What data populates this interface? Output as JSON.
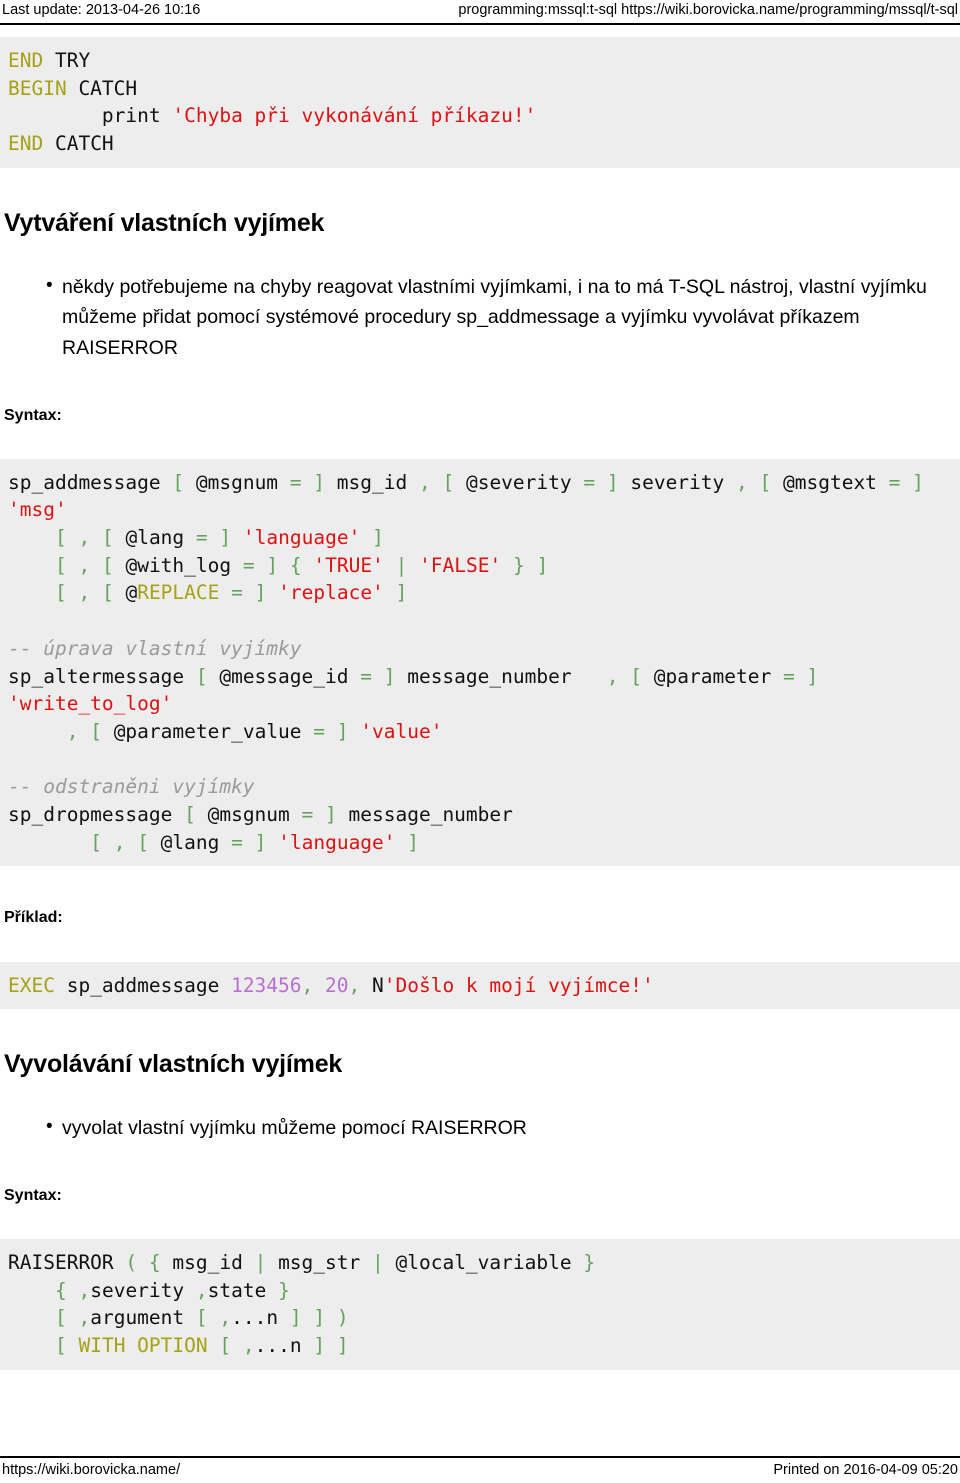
{
  "header": {
    "last_update": "Last update: 2013-04-26 10:16",
    "breadcrumb": "programming:mssql:t-sql https://wiki.borovicka.name/programming/mssql/t-sql"
  },
  "footer": {
    "site_url": "https://wiki.borovicka.name/",
    "printed_on": "Printed on 2016-04-09 05:20"
  },
  "colors": {
    "code_background": "#ededed",
    "keyword": "#a6a215",
    "string": "#dd1111",
    "punctuation": "#63a35c",
    "number": "#b86fd0",
    "comment": "#9a9a9a",
    "rule": "#000000"
  },
  "code_try_catch": {
    "lines": [
      [
        {
          "t": "END",
          "c": "kw"
        },
        {
          "t": " TRY",
          "c": ""
        }
      ],
      [
        {
          "t": "BEGIN",
          "c": "kw"
        },
        {
          "t": " CATCH",
          "c": ""
        }
      ],
      [
        {
          "t": "        print ",
          "c": ""
        },
        {
          "t": "'Chyba při vykonávání příkazu!'",
          "c": "str"
        }
      ],
      [
        {
          "t": "END",
          "c": "kw"
        },
        {
          "t": " CATCH",
          "c": ""
        }
      ]
    ]
  },
  "section_create": {
    "heading": "Vytváření vlastních vyjímek",
    "bullets": [
      "někdy potřebujeme na chyby reagovat vlastními vyjímkami, i na to má T-SQL nástroj, vlastní vyjímku můžeme přidat pomocí systémové procedury sp_addmessage a vyjímku vyvolávat příkazem RAISERROR"
    ],
    "syntax_label": "Syntax:",
    "example_label": "Příklad:"
  },
  "code_sp_syntax": {
    "lines": [
      [
        {
          "t": "sp_addmessage ",
          "c": ""
        },
        {
          "t": "[",
          "c": "pun"
        },
        {
          "t": " @msgnum ",
          "c": ""
        },
        {
          "t": "=",
          "c": "pun"
        },
        {
          "t": " ",
          "c": ""
        },
        {
          "t": "]",
          "c": "pun"
        },
        {
          "t": " msg_id ",
          "c": ""
        },
        {
          "t": ",",
          "c": "pun"
        },
        {
          "t": " ",
          "c": ""
        },
        {
          "t": "[",
          "c": "pun"
        },
        {
          "t": " @severity ",
          "c": ""
        },
        {
          "t": "=",
          "c": "pun"
        },
        {
          "t": " ",
          "c": ""
        },
        {
          "t": "]",
          "c": "pun"
        },
        {
          "t": " severity ",
          "c": ""
        },
        {
          "t": ",",
          "c": "pun"
        },
        {
          "t": " ",
          "c": ""
        },
        {
          "t": "[",
          "c": "pun"
        },
        {
          "t": " @msgtext ",
          "c": ""
        },
        {
          "t": "=",
          "c": "pun"
        },
        {
          "t": " ",
          "c": ""
        },
        {
          "t": "]",
          "c": "pun"
        },
        {
          "t": " ",
          "c": ""
        },
        {
          "t": "'msg'",
          "c": "str"
        }
      ],
      [
        {
          "t": "    ",
          "c": ""
        },
        {
          "t": "[",
          "c": "pun"
        },
        {
          "t": " ",
          "c": ""
        },
        {
          "t": ",",
          "c": "pun"
        },
        {
          "t": " ",
          "c": ""
        },
        {
          "t": "[",
          "c": "pun"
        },
        {
          "t": " @lang ",
          "c": ""
        },
        {
          "t": "=",
          "c": "pun"
        },
        {
          "t": " ",
          "c": ""
        },
        {
          "t": "]",
          "c": "pun"
        },
        {
          "t": " ",
          "c": ""
        },
        {
          "t": "'language'",
          "c": "str"
        },
        {
          "t": " ",
          "c": ""
        },
        {
          "t": "]",
          "c": "pun"
        }
      ],
      [
        {
          "t": "    ",
          "c": ""
        },
        {
          "t": "[",
          "c": "pun"
        },
        {
          "t": " ",
          "c": ""
        },
        {
          "t": ",",
          "c": "pun"
        },
        {
          "t": " ",
          "c": ""
        },
        {
          "t": "[",
          "c": "pun"
        },
        {
          "t": " @with_log ",
          "c": ""
        },
        {
          "t": "=",
          "c": "pun"
        },
        {
          "t": " ",
          "c": ""
        },
        {
          "t": "]",
          "c": "pun"
        },
        {
          "t": " ",
          "c": ""
        },
        {
          "t": "{",
          "c": "pun"
        },
        {
          "t": " ",
          "c": ""
        },
        {
          "t": "'TRUE'",
          "c": "str"
        },
        {
          "t": " ",
          "c": ""
        },
        {
          "t": "|",
          "c": "pun"
        },
        {
          "t": " ",
          "c": ""
        },
        {
          "t": "'FALSE'",
          "c": "str"
        },
        {
          "t": " ",
          "c": ""
        },
        {
          "t": "}",
          "c": "pun"
        },
        {
          "t": " ",
          "c": ""
        },
        {
          "t": "]",
          "c": "pun"
        }
      ],
      [
        {
          "t": "    ",
          "c": ""
        },
        {
          "t": "[",
          "c": "pun"
        },
        {
          "t": " ",
          "c": ""
        },
        {
          "t": ",",
          "c": "pun"
        },
        {
          "t": " ",
          "c": ""
        },
        {
          "t": "[",
          "c": "pun"
        },
        {
          "t": " @",
          "c": ""
        },
        {
          "t": "REPLACE",
          "c": "kw"
        },
        {
          "t": " ",
          "c": ""
        },
        {
          "t": "=",
          "c": "pun"
        },
        {
          "t": " ",
          "c": ""
        },
        {
          "t": "]",
          "c": "pun"
        },
        {
          "t": " ",
          "c": ""
        },
        {
          "t": "'replace'",
          "c": "str"
        },
        {
          "t": " ",
          "c": ""
        },
        {
          "t": "]",
          "c": "pun"
        }
      ],
      [
        {
          "t": "",
          "c": ""
        }
      ],
      [
        {
          "t": "-- úprava vlastní vyjímky",
          "c": "com"
        }
      ],
      [
        {
          "t": "sp_altermessage ",
          "c": ""
        },
        {
          "t": "[",
          "c": "pun"
        },
        {
          "t": " @message_id ",
          "c": ""
        },
        {
          "t": "=",
          "c": "pun"
        },
        {
          "t": " ",
          "c": ""
        },
        {
          "t": "]",
          "c": "pun"
        },
        {
          "t": " message_number   ",
          "c": ""
        },
        {
          "t": ",",
          "c": "pun"
        },
        {
          "t": " ",
          "c": ""
        },
        {
          "t": "[",
          "c": "pun"
        },
        {
          "t": " @parameter ",
          "c": ""
        },
        {
          "t": "=",
          "c": "pun"
        },
        {
          "t": " ",
          "c": ""
        },
        {
          "t": "]",
          "c": "pun"
        },
        {
          "t": " ",
          "c": ""
        },
        {
          "t": "'write_to_log'",
          "c": "str"
        }
      ],
      [
        {
          "t": "     ",
          "c": ""
        },
        {
          "t": ",",
          "c": "pun"
        },
        {
          "t": " ",
          "c": ""
        },
        {
          "t": "[",
          "c": "pun"
        },
        {
          "t": " @parameter_value ",
          "c": ""
        },
        {
          "t": "=",
          "c": "pun"
        },
        {
          "t": " ",
          "c": ""
        },
        {
          "t": "]",
          "c": "pun"
        },
        {
          "t": " ",
          "c": ""
        },
        {
          "t": "'value'",
          "c": "str"
        }
      ],
      [
        {
          "t": "",
          "c": ""
        }
      ],
      [
        {
          "t": "-- odstraněni vyjímky",
          "c": "com"
        }
      ],
      [
        {
          "t": "sp_dropmessage ",
          "c": ""
        },
        {
          "t": "[",
          "c": "pun"
        },
        {
          "t": " @msgnum ",
          "c": ""
        },
        {
          "t": "=",
          "c": "pun"
        },
        {
          "t": " ",
          "c": ""
        },
        {
          "t": "]",
          "c": "pun"
        },
        {
          "t": " message_number",
          "c": ""
        }
      ],
      [
        {
          "t": "       ",
          "c": ""
        },
        {
          "t": "[",
          "c": "pun"
        },
        {
          "t": " ",
          "c": ""
        },
        {
          "t": ",",
          "c": "pun"
        },
        {
          "t": " ",
          "c": ""
        },
        {
          "t": "[",
          "c": "pun"
        },
        {
          "t": " @lang ",
          "c": ""
        },
        {
          "t": "=",
          "c": "pun"
        },
        {
          "t": " ",
          "c": ""
        },
        {
          "t": "]",
          "c": "pun"
        },
        {
          "t": " ",
          "c": ""
        },
        {
          "t": "'language'",
          "c": "str"
        },
        {
          "t": " ",
          "c": ""
        },
        {
          "t": "]",
          "c": "pun"
        }
      ]
    ]
  },
  "code_example": {
    "lines": [
      [
        {
          "t": "EXEC",
          "c": "kw"
        },
        {
          "t": " sp_addmessage ",
          "c": ""
        },
        {
          "t": "123456",
          "c": "num"
        },
        {
          "t": ",",
          "c": "pun"
        },
        {
          "t": " ",
          "c": ""
        },
        {
          "t": "20",
          "c": "num"
        },
        {
          "t": ",",
          "c": "pun"
        },
        {
          "t": " N",
          "c": ""
        },
        {
          "t": "'Došlo k mojí vyjímce!'",
          "c": "str"
        }
      ]
    ]
  },
  "section_raise": {
    "heading": "Vyvolávání vlastních vyjímek",
    "bullets": [
      "vyvolat vlastní vyjímku můžeme pomocí RAISERROR"
    ],
    "syntax_label": "Syntax:"
  },
  "code_raiserror": {
    "lines": [
      [
        {
          "t": "RAISERROR ",
          "c": ""
        },
        {
          "t": "(",
          "c": "pun"
        },
        {
          "t": " ",
          "c": ""
        },
        {
          "t": "{",
          "c": "pun"
        },
        {
          "t": " msg_id ",
          "c": ""
        },
        {
          "t": "|",
          "c": "pun"
        },
        {
          "t": " msg_str ",
          "c": ""
        },
        {
          "t": "|",
          "c": "pun"
        },
        {
          "t": " @local_variable ",
          "c": ""
        },
        {
          "t": "}",
          "c": "pun"
        }
      ],
      [
        {
          "t": "    ",
          "c": ""
        },
        {
          "t": "{",
          "c": "pun"
        },
        {
          "t": " ",
          "c": ""
        },
        {
          "t": ",",
          "c": "pun"
        },
        {
          "t": "severity ",
          "c": ""
        },
        {
          "t": ",",
          "c": "pun"
        },
        {
          "t": "state ",
          "c": ""
        },
        {
          "t": "}",
          "c": "pun"
        }
      ],
      [
        {
          "t": "    ",
          "c": ""
        },
        {
          "t": "[",
          "c": "pun"
        },
        {
          "t": " ",
          "c": ""
        },
        {
          "t": ",",
          "c": "pun"
        },
        {
          "t": "argument ",
          "c": ""
        },
        {
          "t": "[",
          "c": "pun"
        },
        {
          "t": " ",
          "c": ""
        },
        {
          "t": ",",
          "c": "pun"
        },
        {
          "t": "...n ",
          "c": ""
        },
        {
          "t": "]",
          "c": "pun"
        },
        {
          "t": " ",
          "c": ""
        },
        {
          "t": "]",
          "c": "pun"
        },
        {
          "t": " ",
          "c": ""
        },
        {
          "t": ")",
          "c": "pun"
        }
      ],
      [
        {
          "t": "    ",
          "c": ""
        },
        {
          "t": "[",
          "c": "pun"
        },
        {
          "t": " ",
          "c": ""
        },
        {
          "t": "WITH OPTION",
          "c": "kw"
        },
        {
          "t": " ",
          "c": ""
        },
        {
          "t": "[",
          "c": "pun"
        },
        {
          "t": " ",
          "c": ""
        },
        {
          "t": ",",
          "c": "pun"
        },
        {
          "t": "...n ",
          "c": ""
        },
        {
          "t": "]",
          "c": "pun"
        },
        {
          "t": " ",
          "c": ""
        },
        {
          "t": "]",
          "c": "pun"
        }
      ]
    ]
  }
}
